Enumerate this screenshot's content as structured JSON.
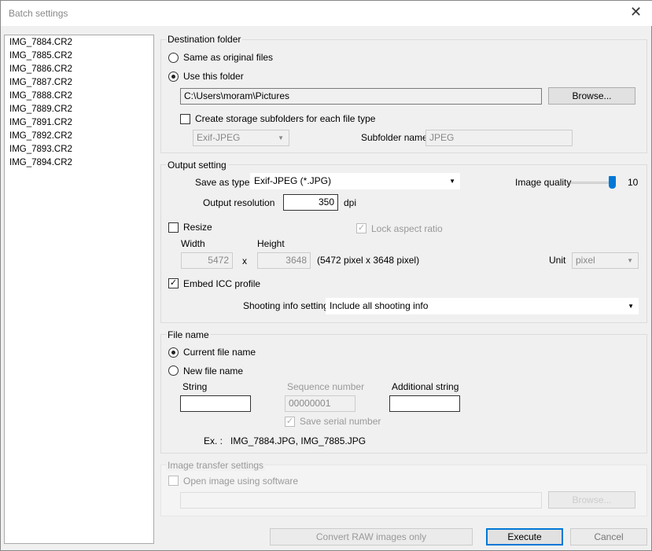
{
  "window": {
    "title": "Batch settings",
    "close_icon": "close-icon"
  },
  "files": [
    "IMG_7884.CR2",
    "IMG_7885.CR2",
    "IMG_7886.CR2",
    "IMG_7887.CR2",
    "IMG_7888.CR2",
    "IMG_7889.CR2",
    "IMG_7891.CR2",
    "IMG_7892.CR2",
    "IMG_7893.CR2",
    "IMG_7894.CR2"
  ],
  "destination": {
    "legend": "Destination folder",
    "same_label": "Same as original files",
    "use_label": "Use this folder",
    "path": "C:\\Users\\moram\\Pictures",
    "browse": "Browse...",
    "subfolders_label": "Create storage subfolders for each file type",
    "subfolder_type": "Exif-JPEG",
    "subfolder_name_label": "Subfolder name",
    "subfolder_name": "JPEG"
  },
  "output": {
    "legend": "Output setting",
    "save_as_label": "Save as type",
    "save_as": "Exif-JPEG (*.JPG)",
    "quality_label": "Image quality",
    "quality": "10",
    "quality_max": 10,
    "resolution_label": "Output resolution",
    "resolution": "350",
    "dpi": "dpi",
    "resize_label": "Resize",
    "lock_label": "Lock aspect ratio",
    "width_label": "Width",
    "height_label": "Height",
    "width": "5472",
    "x": "x",
    "height": "3648",
    "size_text": "(5472 pixel x 3648 pixel)",
    "unit_label": "Unit",
    "unit": "pixel",
    "icc_label": "Embed ICC profile",
    "shooting_label": "Shooting info setting",
    "shooting": "Include all shooting info"
  },
  "filename": {
    "legend": "File name",
    "current_label": "Current file name",
    "new_label": "New file name",
    "string_label": "String",
    "seq_label": "Sequence number",
    "seq": "00000001",
    "additional_label": "Additional string",
    "serial_label": "Save serial number",
    "ex_label": "Ex. :",
    "ex": "IMG_7884.JPG, IMG_7885.JPG"
  },
  "transfer": {
    "legend": "Image transfer settings",
    "open_label": "Open image using software",
    "browse": "Browse..."
  },
  "buttons": {
    "convert": "Convert RAW images only",
    "execute": "Execute",
    "cancel": "Cancel"
  },
  "colors": {
    "accent": "#0078d7"
  }
}
